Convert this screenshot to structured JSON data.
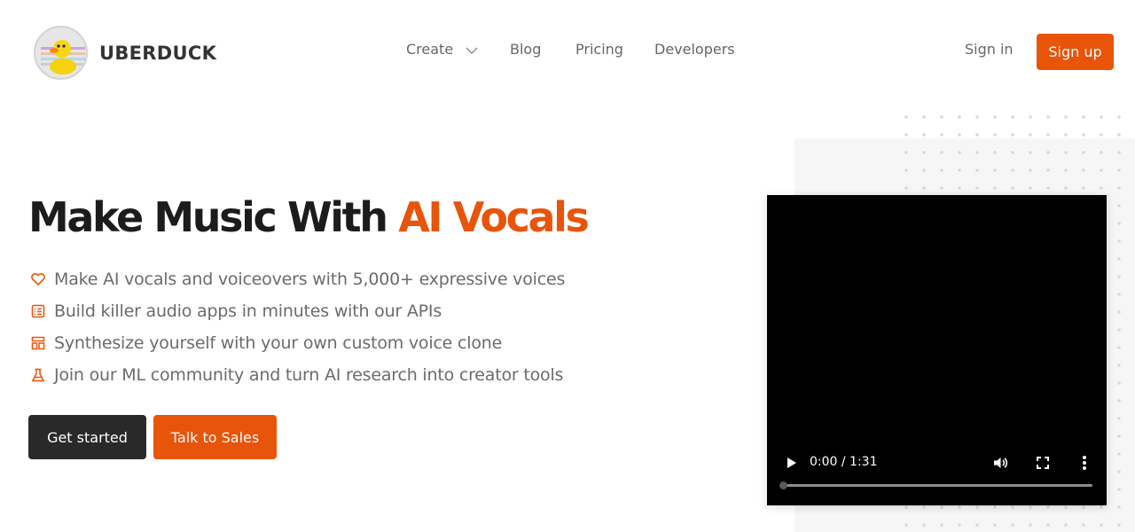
{
  "brand": {
    "name": "UBERDUCK",
    "logo_icon": "duck-logo-icon"
  },
  "nav": {
    "items": [
      {
        "label": "Create",
        "has_dropdown": true
      },
      {
        "label": "Blog"
      },
      {
        "label": "Pricing"
      },
      {
        "label": "Developers"
      }
    ],
    "sign_in": "Sign in",
    "sign_up": "Sign up"
  },
  "hero": {
    "title_main": "Make Music With ",
    "title_accent": "AI Vocals",
    "features": [
      {
        "icon": "heart-icon",
        "text": "Make AI vocals and voiceovers with 5,000+ expressive voices"
      },
      {
        "icon": "list-icon",
        "text": "Build killer audio apps in minutes with our APIs"
      },
      {
        "icon": "layout-icon",
        "text": "Synthesize yourself with your own custom voice clone"
      },
      {
        "icon": "flask-icon",
        "text": "Join our ML community and turn AI research into creator tools"
      }
    ],
    "cta_primary": "Get started",
    "cta_secondary": "Talk to Sales"
  },
  "video": {
    "time": "0:00 / 1:31",
    "progress": 0
  },
  "colors": {
    "accent": "#e8540a",
    "dark_button": "#292929",
    "text_muted": "#6b6b6b",
    "heading": "#1c1c1c"
  }
}
